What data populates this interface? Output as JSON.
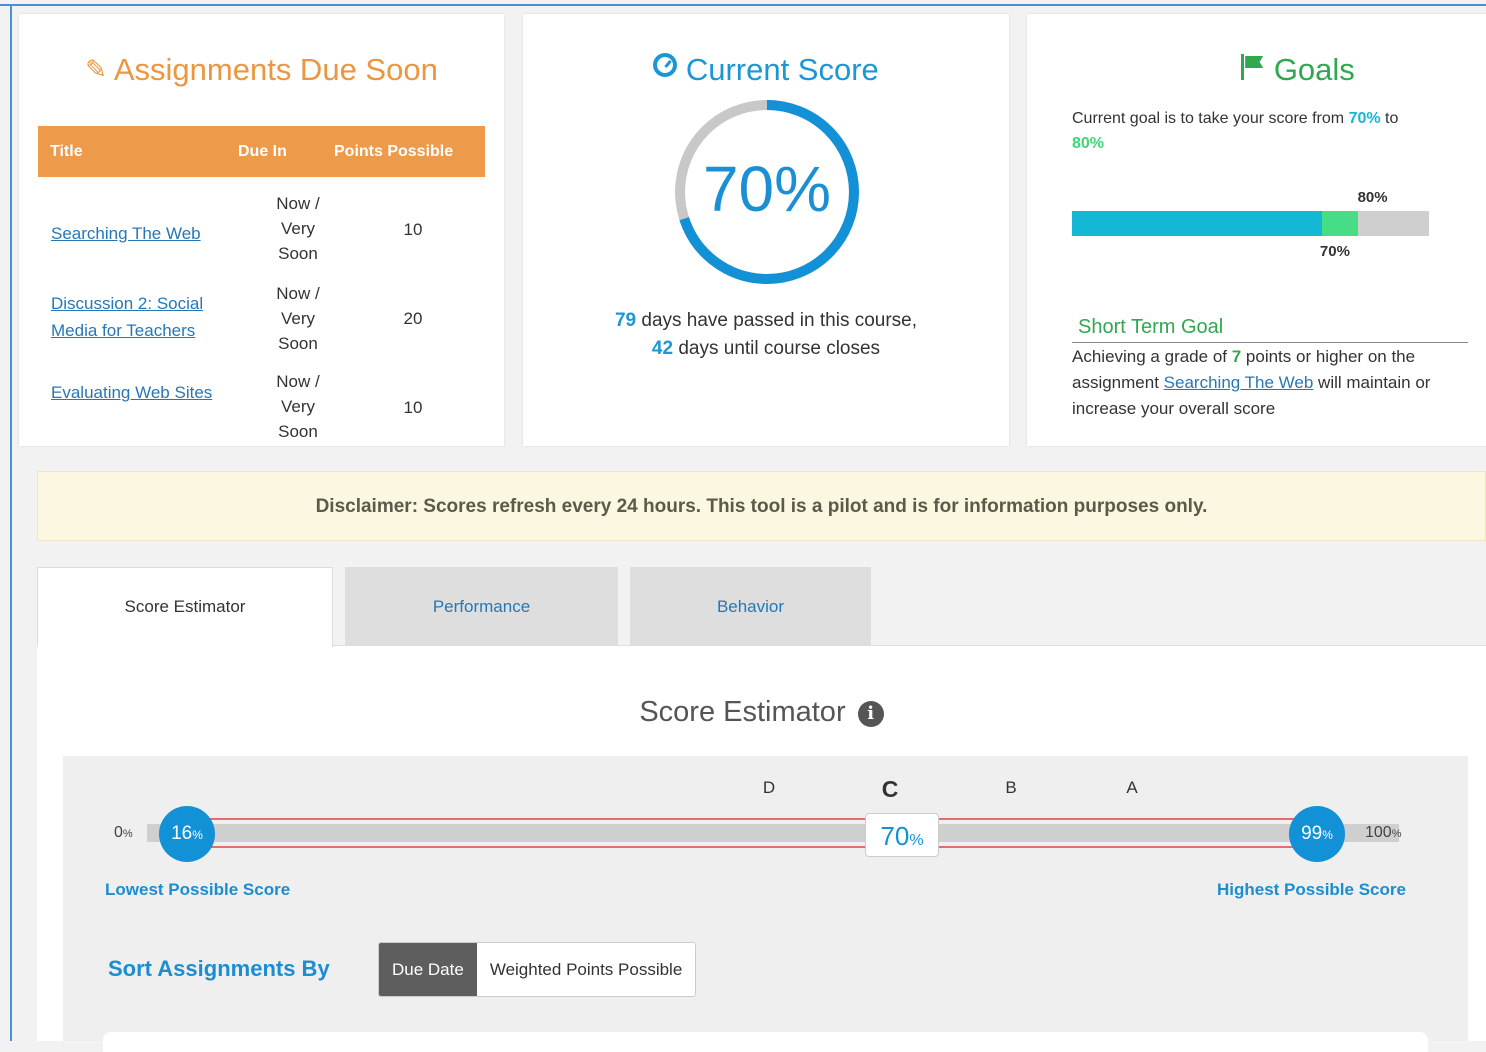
{
  "assignments_due": {
    "title": "Assignments Due Soon",
    "icon": "pencil-icon",
    "columns": [
      "Title",
      "Due In",
      "Points Possible"
    ],
    "rows": [
      {
        "title": "Searching The Web",
        "due": "Now / Very Soon",
        "points": "10"
      },
      {
        "title": "Discussion 2: Social Media for Teachers",
        "due": "Now / Very Soon",
        "points": "20"
      },
      {
        "title": "Evaluating Web Sites",
        "due": "Now / Very Soon",
        "points": "10"
      }
    ],
    "accent": "#ee9a4b"
  },
  "current_score": {
    "title": "Current Score",
    "icon": "dashboard-icon",
    "value": "70%",
    "fraction": 0.7,
    "days_passed": "79",
    "days_passed_text": " days have passed in this course,",
    "days_left": "42",
    "days_left_text": " days until course closes",
    "accent": "#1391d7"
  },
  "goals": {
    "title": "Goals",
    "icon": "flag-icon",
    "text_before": "Current goal is to take your score from ",
    "current": "70%",
    "text_mid": " to ",
    "target": "80%",
    "current_fraction": 0.7,
    "target_fraction": 0.8,
    "short_term_title": "Short Term Goal",
    "short_term_p1": "Achieving a grade of ",
    "short_term_points": "7",
    "short_term_p2": " points or higher on the assignment ",
    "short_term_link": "Searching The Web",
    "short_term_p3": " will maintain or increase your overall score"
  },
  "disclaimer": "Disclaimer: Scores refresh every 24 hours. This tool is a pilot and is for information purposes only.",
  "tabs": [
    {
      "label": "Score Estimator",
      "active": true
    },
    {
      "label": "Performance",
      "active": false
    },
    {
      "label": "Behavior",
      "active": false
    }
  ],
  "estimator": {
    "title": "Score Estimator",
    "min": "0",
    "max": "100",
    "pct_sign": "%",
    "lowest": "16",
    "highest": "99",
    "current": "70",
    "grades": [
      "D",
      "C",
      "B",
      "A"
    ],
    "active_grade": "C",
    "lowest_label": "Lowest Possible Score",
    "highest_label": "Highest Possible Score",
    "sort_label": "Sort Assignments By",
    "sort_options": [
      "Due Date",
      "Weighted Points Possible"
    ],
    "sort_selected": "Due Date"
  }
}
